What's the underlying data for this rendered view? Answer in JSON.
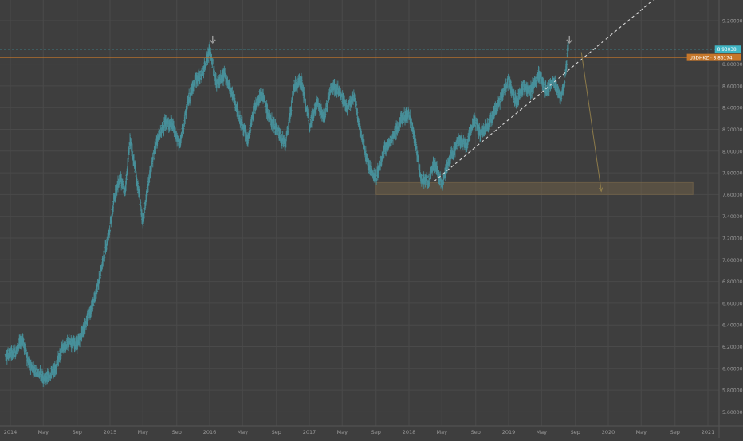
{
  "chart_data": {
    "type": "ohlc",
    "title": "",
    "xlabel": "",
    "ylabel": "",
    "ylim": [
      5.4,
      9.4
    ],
    "grid": true,
    "x_ticks": [
      {
        "label": "2014",
        "t": 2014.0
      },
      {
        "label": "May",
        "t": 2014.33
      },
      {
        "label": "Sep",
        "t": 2014.67
      },
      {
        "label": "2015",
        "t": 2015.0
      },
      {
        "label": "May",
        "t": 2015.33
      },
      {
        "label": "Sep",
        "t": 2015.67
      },
      {
        "label": "2016",
        "t": 2016.0
      },
      {
        "label": "May",
        "t": 2016.33
      },
      {
        "label": "Sep",
        "t": 2016.67
      },
      {
        "label": "2017",
        "t": 2017.0
      },
      {
        "label": "May",
        "t": 2017.33
      },
      {
        "label": "Sep",
        "t": 2017.67
      },
      {
        "label": "2018",
        "t": 2018.0
      },
      {
        "label": "May",
        "t": 2018.33
      },
      {
        "label": "Sep",
        "t": 2018.67
      },
      {
        "label": "2019",
        "t": 2019.0
      },
      {
        "label": "May",
        "t": 2019.33
      },
      {
        "label": "Sep",
        "t": 2019.67
      },
      {
        "label": "2020",
        "t": 2020.0
      },
      {
        "label": "May",
        "t": 2020.33
      },
      {
        "label": "Sep",
        "t": 2020.67
      },
      {
        "label": "2021",
        "t": 2021.0
      }
    ],
    "y_ticks": [
      "9.20000",
      "8.80000",
      "8.60000",
      "8.40000",
      "8.20000",
      "8.00000",
      "7.80000",
      "7.60000",
      "7.40000",
      "7.20000",
      "7.00000",
      "6.80000",
      "6.60000",
      "6.40000",
      "6.20000",
      "6.00000",
      "5.80000",
      "5.60000"
    ],
    "price_path": [
      {
        "t": 2013.95,
        "v": 6.12
      },
      {
        "t": 2014.05,
        "v": 6.15
      },
      {
        "t": 2014.12,
        "v": 6.28
      },
      {
        "t": 2014.18,
        "v": 6.05
      },
      {
        "t": 2014.27,
        "v": 5.97
      },
      {
        "t": 2014.35,
        "v": 5.9
      },
      {
        "t": 2014.45,
        "v": 6.0
      },
      {
        "t": 2014.52,
        "v": 6.18
      },
      {
        "t": 2014.6,
        "v": 6.24
      },
      {
        "t": 2014.67,
        "v": 6.22
      },
      {
        "t": 2014.75,
        "v": 6.4
      },
      {
        "t": 2014.85,
        "v": 6.65
      },
      {
        "t": 2014.92,
        "v": 6.95
      },
      {
        "t": 2015.0,
        "v": 7.3
      },
      {
        "t": 2015.05,
        "v": 7.6
      },
      {
        "t": 2015.1,
        "v": 7.75
      },
      {
        "t": 2015.15,
        "v": 7.62
      },
      {
        "t": 2015.2,
        "v": 8.1
      },
      {
        "t": 2015.25,
        "v": 7.85
      },
      {
        "t": 2015.33,
        "v": 7.35
      },
      {
        "t": 2015.4,
        "v": 7.8
      },
      {
        "t": 2015.47,
        "v": 8.1
      },
      {
        "t": 2015.55,
        "v": 8.25
      },
      {
        "t": 2015.62,
        "v": 8.25
      },
      {
        "t": 2015.7,
        "v": 8.05
      },
      {
        "t": 2015.78,
        "v": 8.45
      },
      {
        "t": 2015.85,
        "v": 8.65
      },
      {
        "t": 2015.93,
        "v": 8.72
      },
      {
        "t": 2016.0,
        "v": 8.93
      },
      {
        "t": 2016.07,
        "v": 8.62
      },
      {
        "t": 2016.15,
        "v": 8.7
      },
      {
        "t": 2016.22,
        "v": 8.55
      },
      {
        "t": 2016.3,
        "v": 8.3
      },
      {
        "t": 2016.38,
        "v": 8.1
      },
      {
        "t": 2016.45,
        "v": 8.4
      },
      {
        "t": 2016.52,
        "v": 8.55
      },
      {
        "t": 2016.6,
        "v": 8.3
      },
      {
        "t": 2016.68,
        "v": 8.2
      },
      {
        "t": 2016.76,
        "v": 8.05
      },
      {
        "t": 2016.85,
        "v": 8.6
      },
      {
        "t": 2016.92,
        "v": 8.65
      },
      {
        "t": 2017.0,
        "v": 8.25
      },
      {
        "t": 2017.08,
        "v": 8.45
      },
      {
        "t": 2017.15,
        "v": 8.3
      },
      {
        "t": 2017.22,
        "v": 8.6
      },
      {
        "t": 2017.3,
        "v": 8.55
      },
      {
        "t": 2017.38,
        "v": 8.4
      },
      {
        "t": 2017.45,
        "v": 8.5
      },
      {
        "t": 2017.52,
        "v": 8.15
      },
      {
        "t": 2017.6,
        "v": 7.85
      },
      {
        "t": 2017.67,
        "v": 7.75
      },
      {
        "t": 2017.75,
        "v": 8.0
      },
      {
        "t": 2017.85,
        "v": 8.15
      },
      {
        "t": 2017.93,
        "v": 8.3
      },
      {
        "t": 2018.0,
        "v": 8.35
      },
      {
        "t": 2018.06,
        "v": 8.1
      },
      {
        "t": 2018.12,
        "v": 7.75
      },
      {
        "t": 2018.2,
        "v": 7.72
      },
      {
        "t": 2018.25,
        "v": 7.9
      },
      {
        "t": 2018.33,
        "v": 7.7
      },
      {
        "t": 2018.42,
        "v": 7.95
      },
      {
        "t": 2018.5,
        "v": 8.1
      },
      {
        "t": 2018.58,
        "v": 8.05
      },
      {
        "t": 2018.65,
        "v": 8.3
      },
      {
        "t": 2018.72,
        "v": 8.15
      },
      {
        "t": 2018.8,
        "v": 8.25
      },
      {
        "t": 2018.88,
        "v": 8.4
      },
      {
        "t": 2018.95,
        "v": 8.55
      },
      {
        "t": 2019.0,
        "v": 8.65
      },
      {
        "t": 2019.08,
        "v": 8.45
      },
      {
        "t": 2019.15,
        "v": 8.6
      },
      {
        "t": 2019.22,
        "v": 8.55
      },
      {
        "t": 2019.3,
        "v": 8.7
      },
      {
        "t": 2019.38,
        "v": 8.55
      },
      {
        "t": 2019.45,
        "v": 8.65
      },
      {
        "t": 2019.52,
        "v": 8.5
      },
      {
        "t": 2019.56,
        "v": 8.62
      },
      {
        "t": 2019.6,
        "v": 8.98
      }
    ],
    "annotations": {
      "horizontal_levels": [
        {
          "name": "cyan-dashed-level",
          "value": 8.938,
          "color": "#3fb5c4",
          "label": "8.93038",
          "style": "dashed"
        },
        {
          "name": "orange-level",
          "value": 8.862,
          "color": "#c7772a",
          "label": "USDHKZ · 8.86174",
          "style": "solid"
        }
      ],
      "rising_trendline": [
        {
          "t": 2018.25,
          "v": 7.72
        },
        {
          "t": 2020.53,
          "v": 9.45
        }
      ],
      "support_zone": [
        {
          "t": 2017.67,
          "v": 7.71
        },
        {
          "t": 2020.85,
          "v": 7.6
        }
      ],
      "projection_arrow": [
        {
          "t": 2019.73,
          "v": 8.91
        },
        {
          "t": 2019.93,
          "v": 7.63
        }
      ],
      "peak_markers": [
        {
          "t": 2016.03,
          "v": 9.01
        },
        {
          "t": 2019.61,
          "v": 9.01
        }
      ]
    },
    "colors": {
      "background": "#3e3e3e",
      "grid": "#4a4a4a",
      "bars": "#48909a",
      "zone": "#77664a",
      "arrow": "#8c7a4a",
      "trendline": "#d8d8d8",
      "axis_text": "#9a9a9a"
    }
  }
}
